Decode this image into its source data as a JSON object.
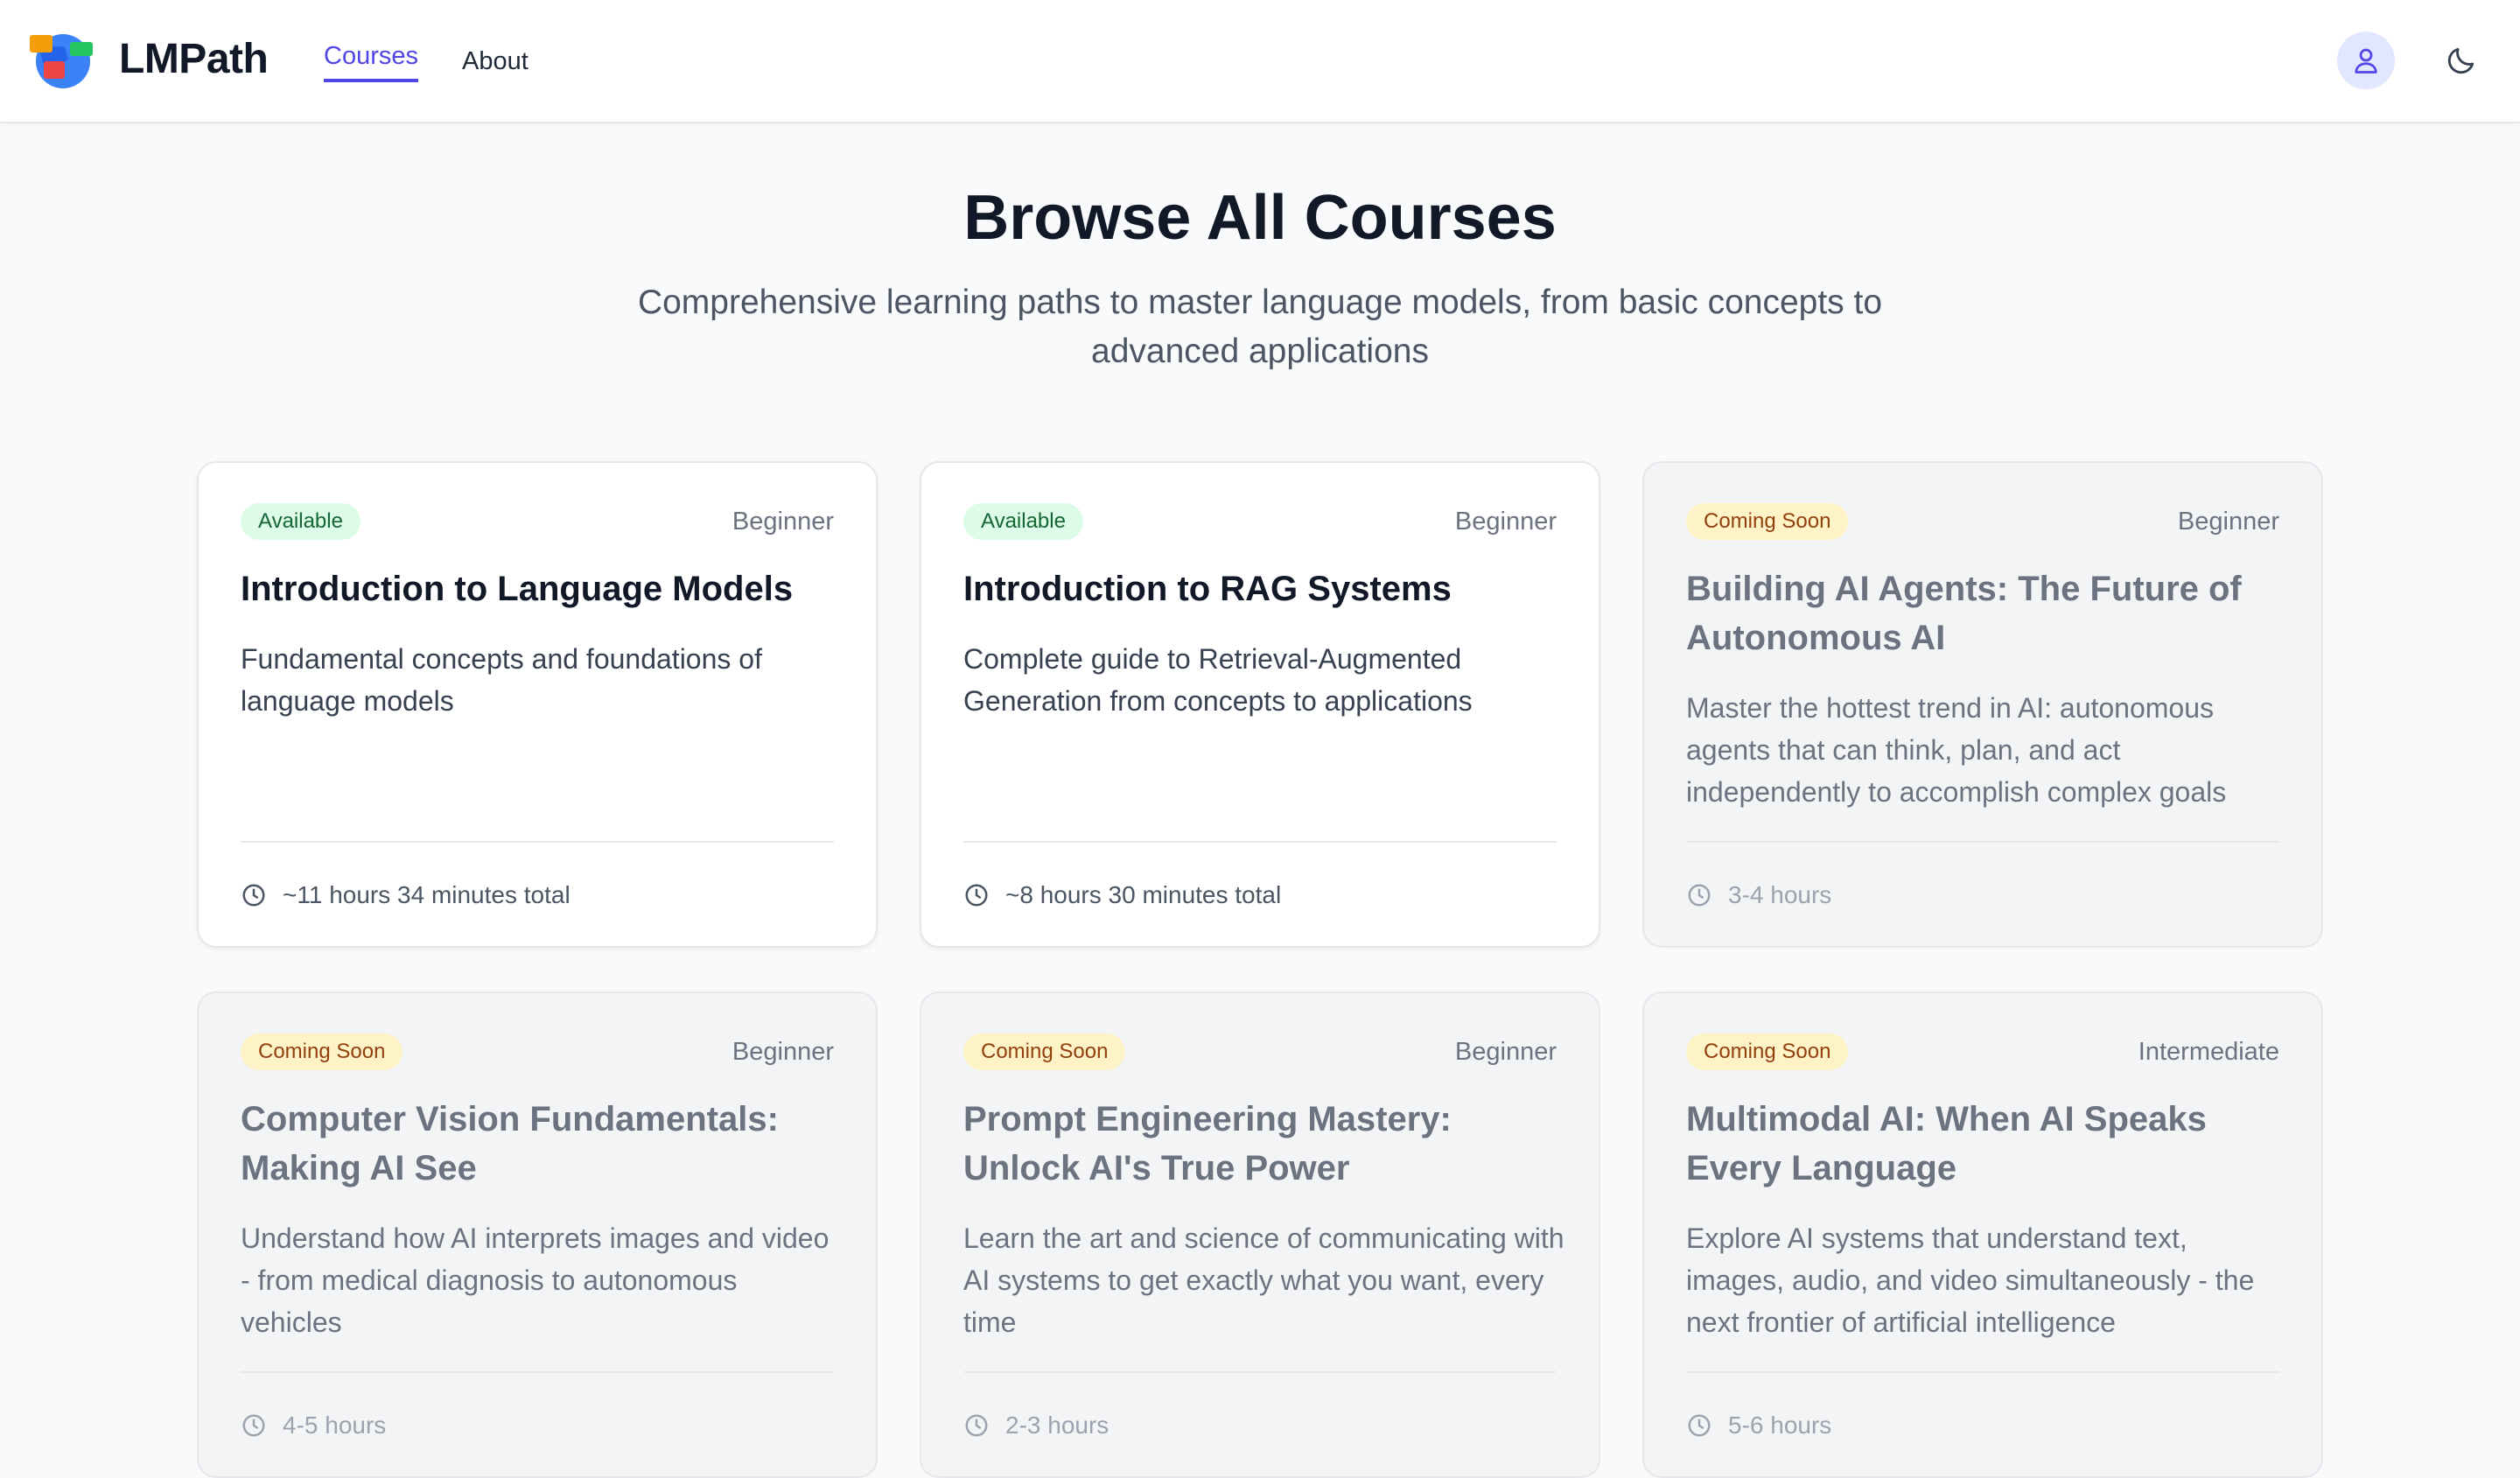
{
  "header": {
    "brand": "LMPath",
    "nav": {
      "courses": "Courses",
      "about": "About"
    }
  },
  "hero": {
    "title": "Browse All Courses",
    "subtitle": "Comprehensive learning paths to master language models, from basic concepts to advanced applications"
  },
  "courses": [
    {
      "status": "Available",
      "level": "Beginner",
      "title": "Introduction to Language Models",
      "description": "Fundamental concepts and foundations of language models",
      "duration": "~11 hours 34 minutes total"
    },
    {
      "status": "Available",
      "level": "Beginner",
      "title": "Introduction to RAG Systems",
      "description": "Complete guide to Retrieval-Augmented Generation from concepts to applications",
      "duration": "~8 hours 30 minutes total"
    },
    {
      "status": "Coming Soon",
      "level": "Beginner",
      "title": "Building AI Agents: The Future of Autonomous AI",
      "description": "Master the hottest trend in AI: autonomous agents that can think, plan, and act independently to accomplish complex goals",
      "duration": "3-4 hours"
    },
    {
      "status": "Coming Soon",
      "level": "Beginner",
      "title": "Computer Vision Fundamentals: Making AI See",
      "description": "Understand how AI interprets images and video - from medical diagnosis to autonomous vehicles",
      "duration": "4-5 hours"
    },
    {
      "status": "Coming Soon",
      "level": "Beginner",
      "title": "Prompt Engineering Mastery: Unlock AI's True Power",
      "description": "Learn the art and science of communicating with AI systems to get exactly what you want, every time",
      "duration": "2-3 hours"
    },
    {
      "status": "Coming Soon",
      "level": "Intermediate",
      "title": "Multimodal AI: When AI Speaks Every Language",
      "description": "Explore AI systems that understand text, images, audio, and video simultaneously - the next frontier of artificial intelligence",
      "duration": "5-6 hours"
    }
  ],
  "colors": {
    "accent": "#4f46e5",
    "available_bg": "#dcfce7",
    "coming_bg": "#fef3c7"
  }
}
